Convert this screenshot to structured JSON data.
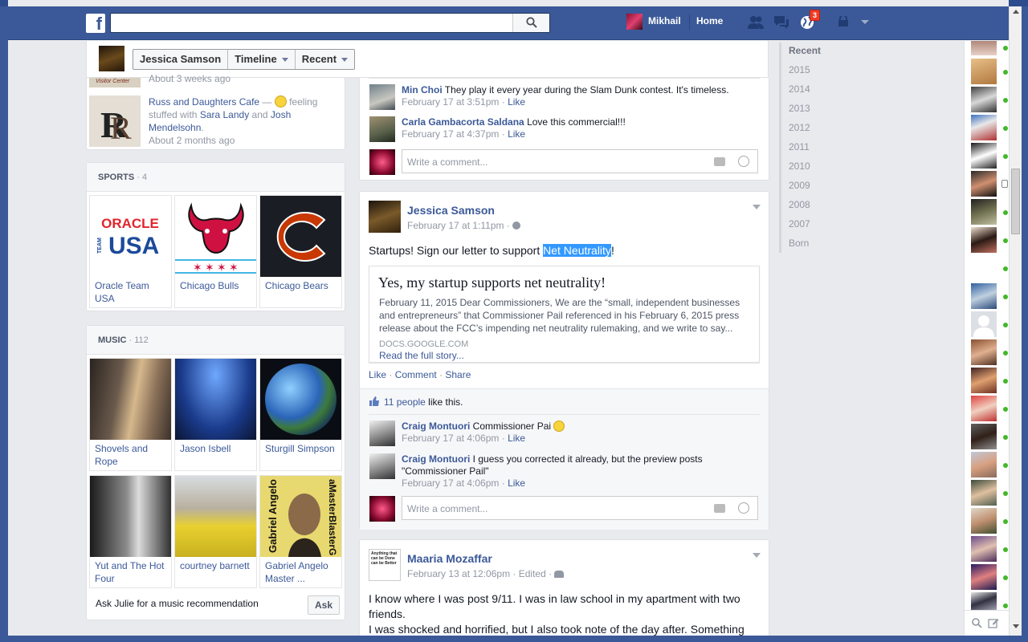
{
  "header": {
    "search_placeholder": "",
    "user_name": "Mikhail",
    "home_label": "Home",
    "notif_count": "3"
  },
  "timeline_bar": {
    "name": "Jessica Samson",
    "timeline_label": "Timeline",
    "recent_label": "Recent"
  },
  "places": {
    "partial_caption": "Visitor Center",
    "partial_time": "About 3 weeks ago",
    "item": {
      "name": "Russ and Daughters Cafe",
      "dash": " — ",
      "feeling": "feeling stuffed with ",
      "friend1": "Sara Landy",
      "and": " and ",
      "friend2": "Josh Mendelsohn",
      "end": ".",
      "time": "About 2 months ago"
    }
  },
  "sports": {
    "title": "Sports",
    "count": "· 4",
    "items": [
      {
        "label": "Oracle Team USA"
      },
      {
        "label": "Chicago Bulls"
      },
      {
        "label": "Chicago Bears"
      }
    ],
    "oracle_logo": {
      "line1": "ORACLE",
      "team": "TEAM",
      "usa": "USA"
    }
  },
  "music": {
    "title": "Music",
    "count": "· 112",
    "items": [
      {
        "label": "Shovels and Rope"
      },
      {
        "label": "Jason Isbell"
      },
      {
        "label": "Sturgill Simpson"
      },
      {
        "label": "Yut and The Hot Four"
      },
      {
        "label": "courtney barnett"
      },
      {
        "label": "Gabriel Angelo Master ..."
      }
    ],
    "ask_text": "Ask Julie for a music recommendation",
    "ask_button": "Ask",
    "gabriel_art": {
      "left": "Gabriel Angelo",
      "right": "aMasterBlasterG"
    }
  },
  "post1": {
    "comments": [
      {
        "name": "Min Choi",
        "text": "They play it every year during the Slam Dunk contest. It's timeless.",
        "time": "February 17 at 3:51pm",
        "like": "Like"
      },
      {
        "name": "Carla Gambacorta Saldana",
        "text": "Love this commercial!!!",
        "time": "February 17 at 4:37pm",
        "like": "Like"
      }
    ],
    "write_placeholder": "Write a comment..."
  },
  "post2": {
    "author": "Jessica Samson",
    "time": "February 17 at 1:11pm",
    "text_before": "Startups! Sign our letter to support ",
    "text_highlight": "Net Neutrality",
    "text_after": "!",
    "link": {
      "title": "Yes, my startup supports net neutrality!",
      "desc": "February 11, 2015 Dear Commissioners, We are the “small, independent businesses and entrepreneurs” that Commissioner Pail referenced in his February 6, 2015 press release about the FCC’s impending net neutrality rulemaking, and we write to say...",
      "source": "DOCS.GOOGLE.COM",
      "more": "Read the full story..."
    },
    "actions": {
      "like": "Like",
      "comment": "Comment",
      "share": "Share"
    },
    "likes_count": "11 people",
    "likes_suffix": " like this.",
    "comments": [
      {
        "name": "Craig Montuori",
        "text": "Commissioner Pai",
        "time": "February 17 at 4:06pm",
        "like": "Like"
      },
      {
        "name": "Craig Montuori",
        "text": "I guess you corrected it already, but the preview posts \"Commissioner Pail\"",
        "time": "February 17 at 4:06pm",
        "like": "Like"
      }
    ],
    "write_placeholder": "Write a comment..."
  },
  "post3": {
    "author": "Maaria Mozaffar",
    "time": "February 13 at 12:06pm",
    "edited": "Edited",
    "thumb_text": "Anything that can be Done can be Better",
    "text": "I know where I was post 9/11. I was in law school in my apartment with two friends.",
    "text2": "I was shocked and horrified, but I also took note of the day after. Something"
  },
  "years": {
    "items": [
      "Recent",
      "2015",
      "2014",
      "2013",
      "2012",
      "2011",
      "2010",
      "2009",
      "2008",
      "2007",
      "Born"
    ]
  },
  "colors": {
    "brand": "#3b5998",
    "online": "#42b72a",
    "page_bg": "#e9eaed",
    "highlight": "#3399ff"
  }
}
